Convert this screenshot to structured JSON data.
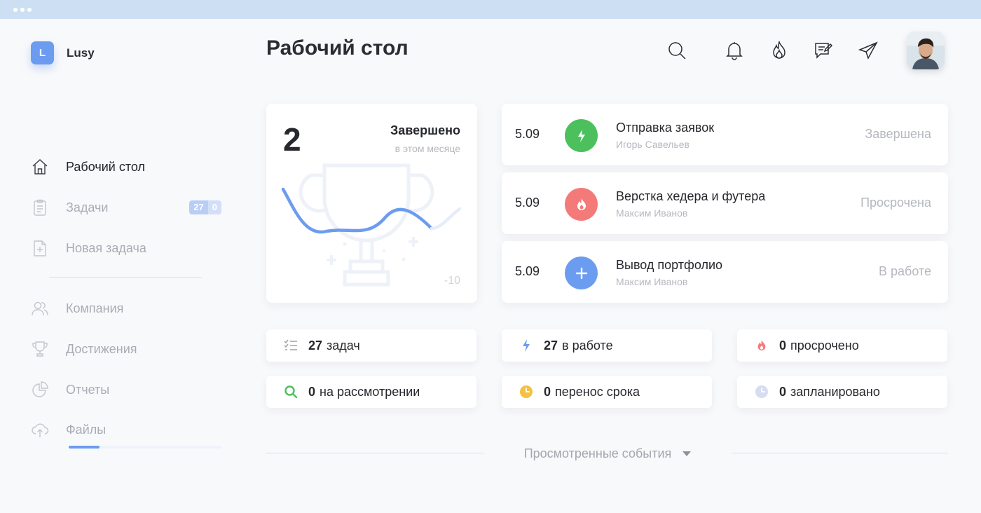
{
  "brand": {
    "letter": "L",
    "name": "Lusy",
    "color": "#6c9cf0"
  },
  "sidebar": {
    "items": [
      {
        "label": "Рабочий стол",
        "icon": "home-icon",
        "active": true
      },
      {
        "label": "Задачи",
        "icon": "clipboard-icon",
        "badge": [
          "27",
          "0"
        ]
      },
      {
        "label": "Новая задача",
        "icon": "new-document-icon"
      },
      {
        "label": "Компания",
        "icon": "users-icon"
      },
      {
        "label": "Достижения",
        "icon": "trophy-icon"
      },
      {
        "label": "Отчеты",
        "icon": "pie-chart-icon"
      },
      {
        "label": "Файлы",
        "icon": "cloud-upload-icon"
      }
    ]
  },
  "header": {
    "title": "Рабочий стол",
    "icons": [
      "search-icon",
      "bell-icon",
      "fire-icon",
      "chat-edit-icon",
      "send-icon",
      "avatar"
    ]
  },
  "summary": {
    "count": "2",
    "title": "Завершено",
    "subtitle": "в этом месяце",
    "chart_label": "-10"
  },
  "tasks": [
    {
      "date": "5.09",
      "name": "Отправка заявок",
      "person": "Игорь Савельев",
      "status": "Завершена",
      "icon": "lightning-icon",
      "color": "#4cc05d"
    },
    {
      "date": "5.09",
      "name": "Верстка хедера и футера",
      "person": "Максим Иванов",
      "status": "Просрочена",
      "icon": "fire-icon",
      "color": "#f47a7a"
    },
    {
      "date": "5.09",
      "name": "Вывод портфолио",
      "person": "Максим Иванов",
      "status": "В работе",
      "icon": "plus-icon",
      "color": "#6c9cf0"
    }
  ],
  "stats": [
    {
      "num": "27",
      "text": "задач",
      "icon": "checklist-icon",
      "color": "#9ea2aa"
    },
    {
      "num": "27",
      "text": "в работе",
      "icon": "lightning-icon",
      "color": "#6c9cf0"
    },
    {
      "num": "0",
      "text": "просрочено",
      "icon": "fire-icon",
      "color": "#f47a7a"
    },
    {
      "num": "0",
      "text": "на рассмотрении",
      "icon": "search-icon",
      "color": "#4cc05d"
    },
    {
      "num": "0",
      "text": "перенос срока",
      "icon": "clock-icon",
      "color": "#f5c142"
    },
    {
      "num": "0",
      "text": "запланировано",
      "icon": "clock-icon",
      "color": "#d7dcf0"
    }
  ],
  "events": {
    "label": "Просмотренные события"
  }
}
